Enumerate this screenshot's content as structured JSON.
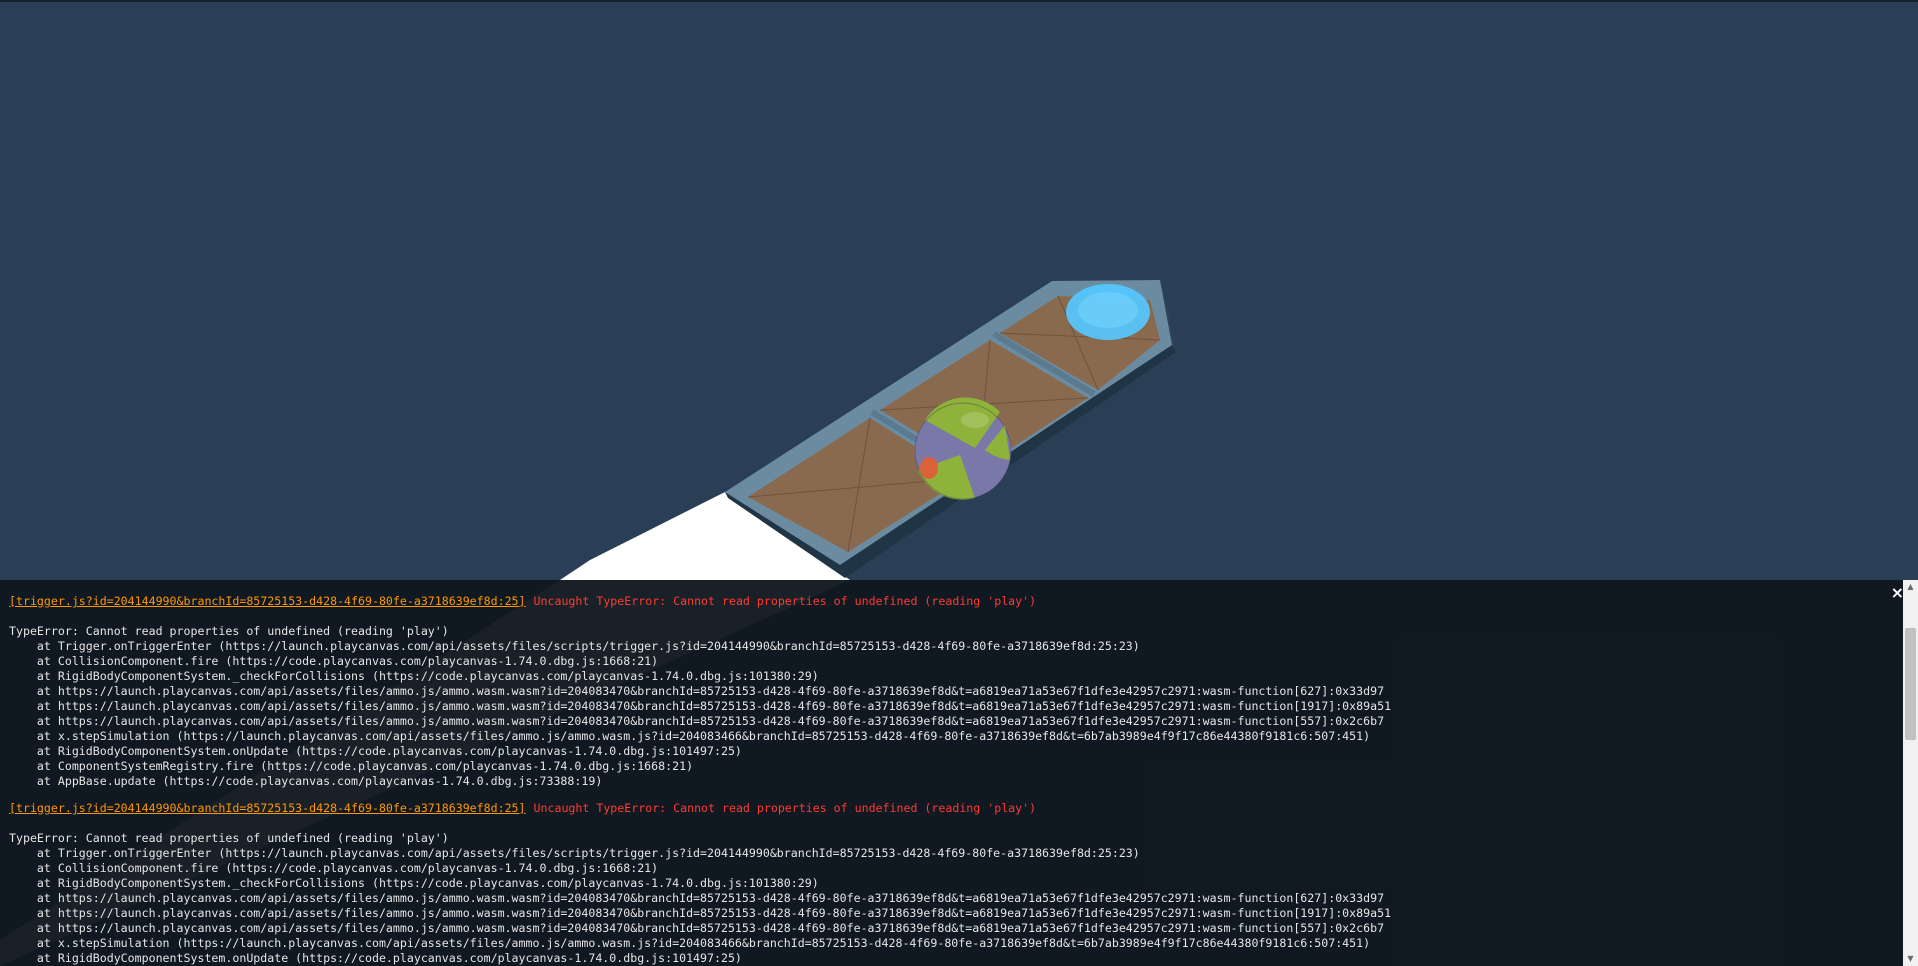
{
  "console": {
    "close_glyph": "×",
    "entries": [
      {
        "source": "[trigger.js?id=204144990&branchId=85725153-d428-4f69-80fe-a3718639ef8d:25]",
        "message": "Uncaught TypeError: Cannot read properties of undefined (reading 'play')",
        "stack": [
          "TypeError: Cannot read properties of undefined (reading 'play')",
          "    at Trigger.onTriggerEnter (https://launch.playcanvas.com/api/assets/files/scripts/trigger.js?id=204144990&branchId=85725153-d428-4f69-80fe-a3718639ef8d:25:23)",
          "    at CollisionComponent.fire (https://code.playcanvas.com/playcanvas-1.74.0.dbg.js:1668:21)",
          "    at RigidBodyComponentSystem._checkForCollisions (https://code.playcanvas.com/playcanvas-1.74.0.dbg.js:101380:29)",
          "    at https://launch.playcanvas.com/api/assets/files/ammo.js/ammo.wasm.wasm?id=204083470&branchId=85725153-d428-4f69-80fe-a3718639ef8d&t=a6819ea71a53e67f1dfe3e42957c2971:wasm-function[627]:0x33d97",
          "    at https://launch.playcanvas.com/api/assets/files/ammo.js/ammo.wasm.wasm?id=204083470&branchId=85725153-d428-4f69-80fe-a3718639ef8d&t=a6819ea71a53e67f1dfe3e42957c2971:wasm-function[1917]:0x89a51",
          "    at https://launch.playcanvas.com/api/assets/files/ammo.js/ammo.wasm.wasm?id=204083470&branchId=85725153-d428-4f69-80fe-a3718639ef8d&t=a6819ea71a53e67f1dfe3e42957c2971:wasm-function[557]:0x2c6b7",
          "    at x.stepSimulation (https://launch.playcanvas.com/api/assets/files/ammo.js/ammo.wasm.js?id=204083466&branchId=85725153-d428-4f69-80fe-a3718639ef8d&t=6b7ab3989e4f9f17c86e44380f9181c6:507:451)",
          "    at RigidBodyComponentSystem.onUpdate (https://code.playcanvas.com/playcanvas-1.74.0.dbg.js:101497:25)",
          "    at ComponentSystemRegistry.fire (https://code.playcanvas.com/playcanvas-1.74.0.dbg.js:1668:21)",
          "    at AppBase.update (https://code.playcanvas.com/playcanvas-1.74.0.dbg.js:73388:19)"
        ]
      },
      {
        "source": "[trigger.js?id=204144990&branchId=85725153-d428-4f69-80fe-a3718639ef8d:25]",
        "message": "Uncaught TypeError: Cannot read properties of undefined (reading 'play')",
        "stack": [
          "TypeError: Cannot read properties of undefined (reading 'play')",
          "    at Trigger.onTriggerEnter (https://launch.playcanvas.com/api/assets/files/scripts/trigger.js?id=204144990&branchId=85725153-d428-4f69-80fe-a3718639ef8d:25:23)",
          "    at CollisionComponent.fire (https://code.playcanvas.com/playcanvas-1.74.0.dbg.js:1668:21)",
          "    at RigidBodyComponentSystem._checkForCollisions (https://code.playcanvas.com/playcanvas-1.74.0.dbg.js:101380:29)",
          "    at https://launch.playcanvas.com/api/assets/files/ammo.js/ammo.wasm.wasm?id=204083470&branchId=85725153-d428-4f69-80fe-a3718639ef8d&t=a6819ea71a53e67f1dfe3e42957c2971:wasm-function[627]:0x33d97",
          "    at https://launch.playcanvas.com/api/assets/files/ammo.js/ammo.wasm.wasm?id=204083470&branchId=85725153-d428-4f69-80fe-a3718639ef8d&t=a6819ea71a53e67f1dfe3e42957c2971:wasm-function[1917]:0x89a51",
          "    at https://launch.playcanvas.com/api/assets/files/ammo.js/ammo.wasm.wasm?id=204083470&branchId=85725153-d428-4f69-80fe-a3718639ef8d&t=a6819ea71a53e67f1dfe3e42957c2971:wasm-function[557]:0x2c6b7",
          "    at x.stepSimulation (https://launch.playcanvas.com/api/assets/files/ammo.js/ammo.wasm.js?id=204083466&branchId=85725153-d428-4f69-80fe-a3718639ef8d&t=6b7ab3989e4f9f17c86e44380f9181c6:507:451)",
          "    at RigidBodyComponentSystem.onUpdate (https://code.playcanvas.com/playcanvas-1.74.0.dbg.js:101497:25)"
        ]
      }
    ]
  },
  "colors": {
    "background": "#2a3e55",
    "error_source": "#ff9800",
    "error_message": "#ff3b30",
    "trigger_pad": "#55c8ff",
    "ball_green": "#8fb23a",
    "ball_purple": "#7a78a8",
    "ball_orange": "#d9623a"
  }
}
